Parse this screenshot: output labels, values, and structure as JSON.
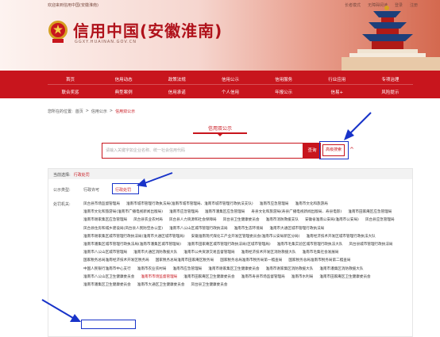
{
  "header": {
    "welcome": "欢迎来到信用中国(安徽淮南)",
    "top_links": [
      "长者模式",
      "无障碍阅读",
      "登录",
      "注册"
    ],
    "site_title": "信用中国(安徽淮南)",
    "domain": "GGXY.HUAINAN.GOV.CN"
  },
  "nav": {
    "row1": [
      "首页",
      "信用动态",
      "政策法规",
      "信用公示",
      "信用服务",
      "行业应用",
      "专项治理"
    ],
    "row2": [
      "联合奖惩",
      "典型案例",
      "信用承诺",
      "个人信用",
      "年报公示",
      "信易+",
      "风险提示"
    ]
  },
  "breadcrumb": {
    "prefix": "您所在的位置:",
    "items": [
      "首页",
      ">",
      "信用公示",
      ">"
    ],
    "current": "信用双公示"
  },
  "section": {
    "title": "信用双公示"
  },
  "search": {
    "placeholder": "请输入关键字如企业名称、统一社会信用代码",
    "button": "查询",
    "advanced": "高级搜索",
    "caret": "^"
  },
  "filter": {
    "current_label": "当前选择:",
    "current_value": "行政处罚",
    "type_label": "公示类型:",
    "type_options": [
      "行政许可",
      "行政处罚"
    ],
    "agency_label": "处罚机关:",
    "agencies": [
      "凤台县市场监督管理局",
      "淮南市城市管理行政执法局(淮南市城市管理局、淮南市城市管理行政执法支队)",
      "淮南市应急管理局",
      "淮南市文化和旅游局",
      "淮南市文化和旅游局(淮南市广播电视新闻出版局)",
      "淮南市应急管理局",
      "淮南市潘集区应急管理局",
      "寿县文化和旅游局(寿县广播电视新闻出版局、寿县电影)",
      "淮南市田家庵区应急管理局",
      "淮南市谢家集区应急管理局",
      "凤台县农业农村局",
      "凤台县人力资源和社会保障局",
      "凤台县卫生健康委员会",
      "淮南市消防救援支队",
      "安徽省淮南公安局(淮南市公安局)",
      "凤台县应急管理局",
      "凤台县住房和城乡建设局(凤台县人民防空办公室)",
      "淮南市八公山区城市管理行政执法局",
      "淮南市生态环境局",
      "淮南市大通区城市管理行政执法局",
      "淮南市谢家集区城市管理行政执法局(淮南市大通区城市管理局)",
      "安徽淮南现代煤化工产业开发区管理委员会(淮南市公安局新区分局)",
      "淮南经济技术开发区城市管理行政执法大队",
      "淮南市潘集区城市管理行政执法局(淮南市潘集区城市管理局)",
      "淮南市田家庵区城市管理行政执法局(区城市管理局)",
      "淮南市毛集实验区城市管理行政执法大队",
      "凤台县城市管理行政执法局",
      "淮南市八公山区城市管理局",
      "淮南市大通区消防救援大队",
      "淮南市公共资源交易监督管理局",
      "淮南经济技术开发区消防救援大队",
      "淮南市毛集社会发展局",
      "国家税务总局淮南经济技术开发区税务局",
      "国家税务总局淮南市田家庵区税务局",
      "国家税务总局淮南市税务局第一稽查局",
      "国家税务总局淮南市税务局第二稽查局",
      "中国人民银行淮南市中心支行",
      "淮南市农业农村局",
      "淮南市应急管理局",
      "淮南市谢家集区卫生健康委员会",
      "淮南市谢家集区消防救援大队",
      "淮南市潘集区消防救援大队",
      "淮南市八公山区卫生健康委员会",
      "淮南市市场监督管理局",
      "淮南市田家庵区卫生健康委员会",
      "淮南市寿县市场监督管理局",
      "淮南市水利局",
      "淮南市田家庵区卫生健康委员会",
      "淮南市潘集区卫生健康委员会",
      "淮南市大通区卫生健康委员会",
      "凤台县卫生健康委员会"
    ]
  },
  "colors": {
    "brand_red": "#c8151d",
    "highlight_blue": "#1833c9"
  }
}
